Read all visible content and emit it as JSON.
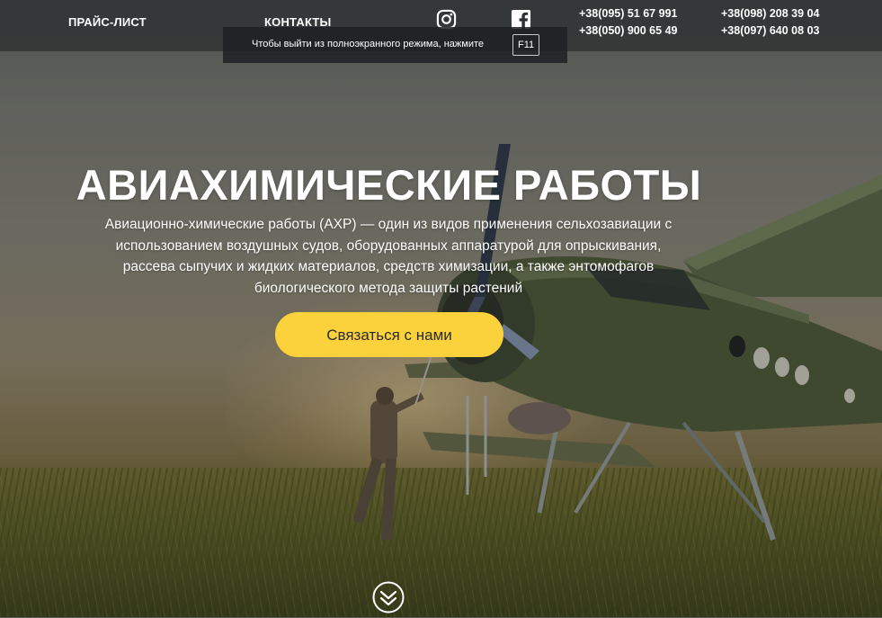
{
  "nav": {
    "price_list": "ПРАЙС-ЛИСТ",
    "contacts": "КОНТАКТЫ"
  },
  "social": {
    "instagram_icon": "instagram-icon",
    "facebook_icon": "facebook-icon"
  },
  "phones": {
    "col1_line1": "+38(095) 51 67 991",
    "col1_line2": "+38(050) 900 65 49",
    "col2_line1": "+38(098) 208 39 04",
    "col2_line2": "+38(097) 640 08 03"
  },
  "fullscreen_notice": {
    "message": "Чтобы выйти из полноэкранного режима, нажмите",
    "key": "F11"
  },
  "hero": {
    "title": "АВИАХИМИЧЕСКИЕ РАБОТЫ",
    "description": "Авиационно-химические работы (АХР) — один из видов применения сельхозавиации с использованием воздушных судов, оборудованных аппаратурой для опрыскивания, рассева сыпучих и жидких материалов, средств химизации, а также энтомофагов биологического метода защиты растений",
    "cta_label": "Связаться с нами",
    "scroll_icon": "double-chevron-down-icon"
  },
  "colors": {
    "accent": "#fcd23c",
    "topbar": "#282c2e",
    "text": "#ffffff"
  }
}
